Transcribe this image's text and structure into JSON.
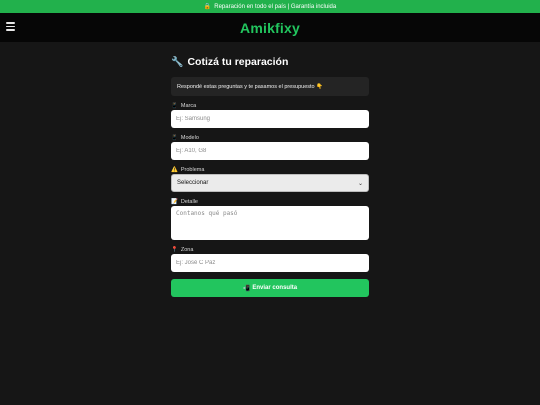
{
  "topbar": {
    "icon": "lock-icon",
    "text": "Reparación en todo el país | Garantía incluida"
  },
  "header": {
    "brand": "Amikfixy",
    "menu_icon": "hamburger-menu-icon"
  },
  "form": {
    "title": "Cotizá tu reparación",
    "title_icon": "🔧",
    "intro": "Respondé estas preguntas y te pasamos el presupuesto 👇",
    "marca": {
      "label": "Marca",
      "icon": "📱",
      "placeholder": "Ej: Samsung",
      "value": ""
    },
    "modelo": {
      "label": "Modelo",
      "icon": "📱",
      "placeholder": "Ej: A10, G8",
      "value": ""
    },
    "problema": {
      "label": "Problema",
      "icon": "⚠️",
      "selected": "Seleccionar"
    },
    "detalle": {
      "label": "Detalle",
      "icon": "📝",
      "placeholder": "Contanos qué pasó",
      "value": ""
    },
    "zona": {
      "label": "Zona",
      "icon": "📍",
      "placeholder": "Ej: José C Paz",
      "value": ""
    },
    "submit": {
      "label": "Enviar consulta",
      "icon": "📲"
    }
  },
  "colors": {
    "accent": "#22c55e",
    "topbar": "#22b14c",
    "background": "#161616",
    "header": "#060606"
  }
}
